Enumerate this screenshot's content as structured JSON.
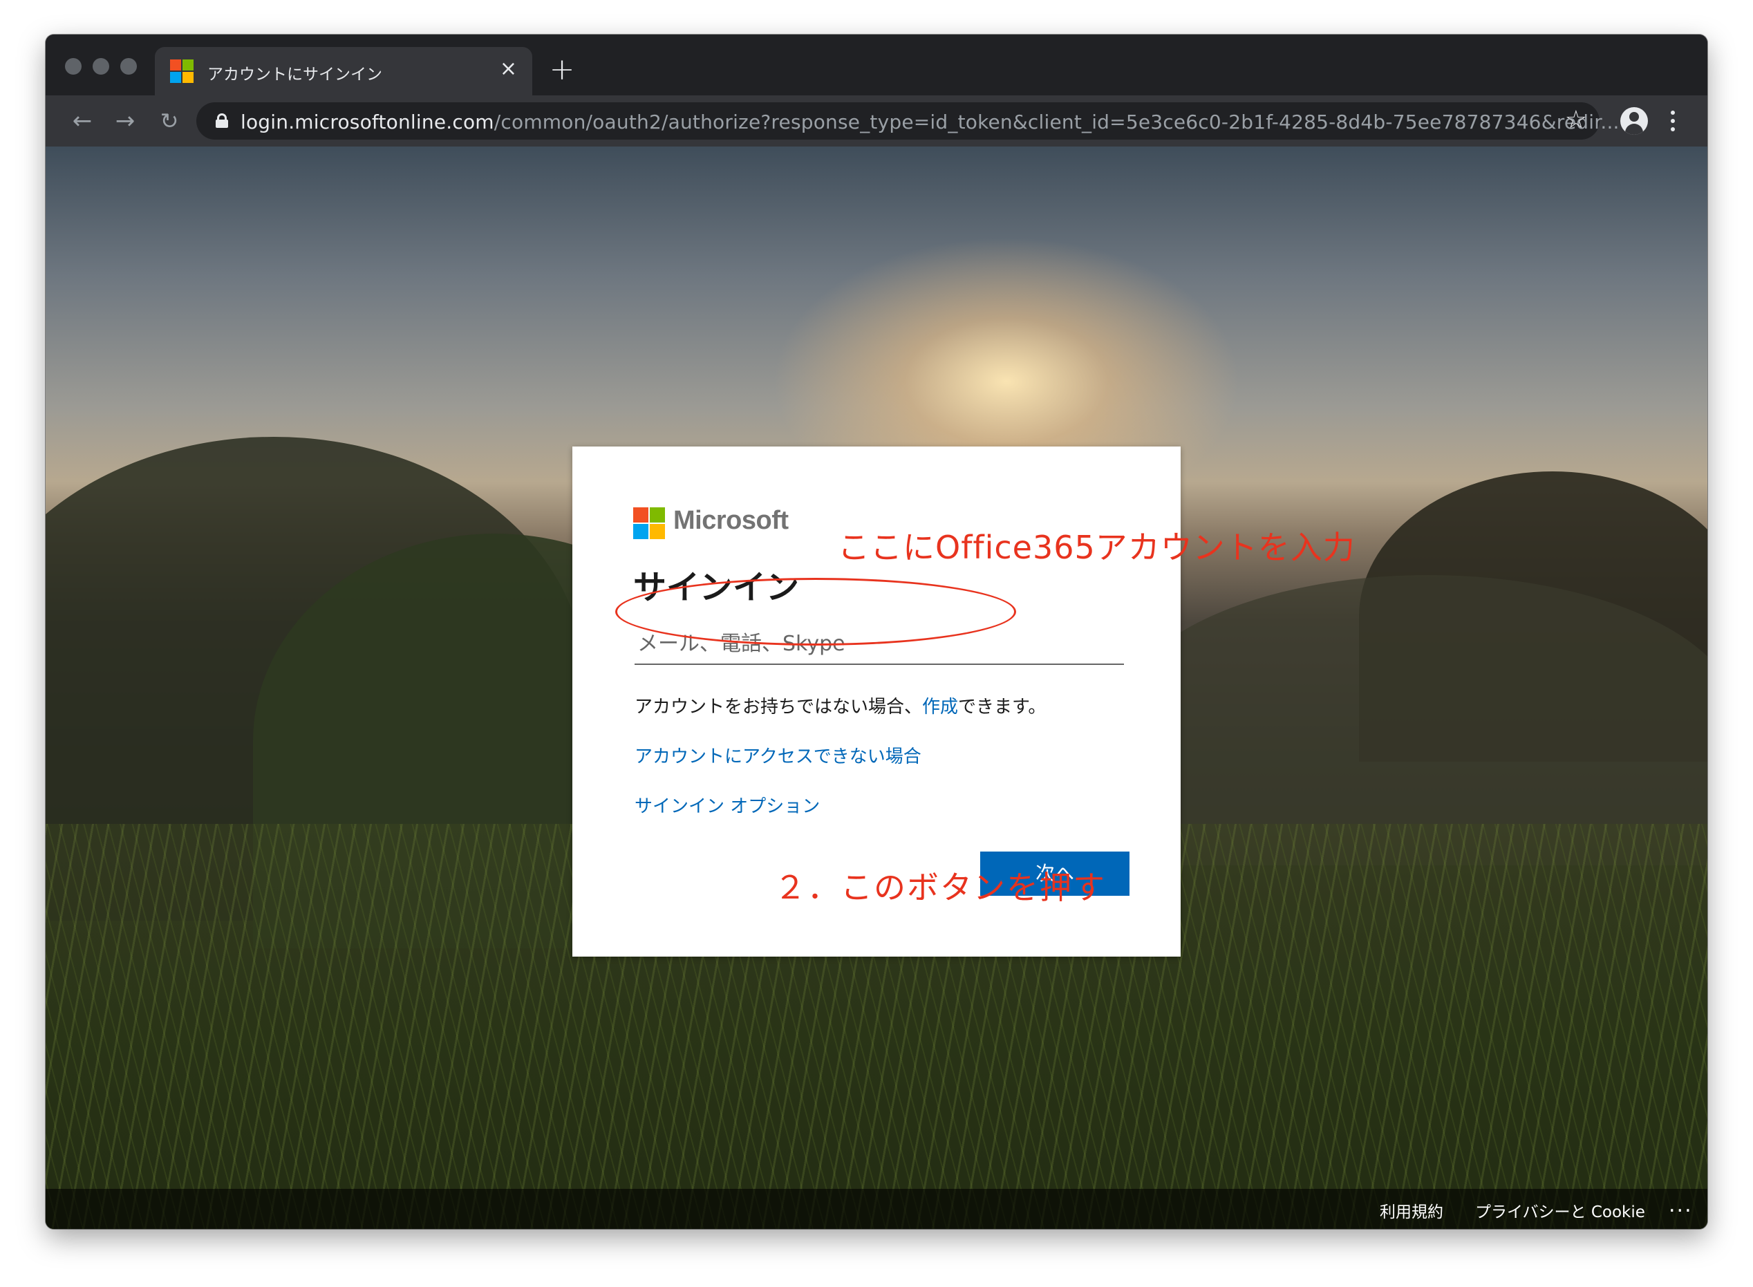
{
  "browser": {
    "tab": {
      "title": "アカウントにサインイン",
      "close_icon": "×"
    },
    "new_tab_icon": "+",
    "nav": {
      "back_icon": "←",
      "forward_icon": "→",
      "reload_icon": "↻"
    },
    "url": {
      "host": "login.microsoftonline.com",
      "path": "/common/oauth2/authorize?response_type=id_token&client_id=5e3ce6c0-2b1f-4285-8d4b-75ee78787346&redir..."
    },
    "bookmark_icon": "☆"
  },
  "brand": {
    "name": "Microsoft",
    "colors": {
      "red": "#f25022",
      "green": "#7fba00",
      "blue": "#00a4ef",
      "yellow": "#ffb900"
    }
  },
  "signin": {
    "title": "サインイン",
    "email_placeholder": "メール、電話、Skype",
    "no_account_prefix": "アカウントをお持ちではない場合、",
    "create_link": "作成",
    "no_account_suffix": "できます。",
    "cant_access": "アカウントにアクセスできない場合",
    "signin_options": "サインイン オプション",
    "next_button": "次へ"
  },
  "annotations": {
    "color": "#e8331e",
    "input_hint": "ここにOffice365アカウントを入力",
    "button_hint": "２．このボタンを押す"
  },
  "footer": {
    "terms": "利用規約",
    "privacy": "プライバシーと Cookie",
    "more": "..."
  }
}
